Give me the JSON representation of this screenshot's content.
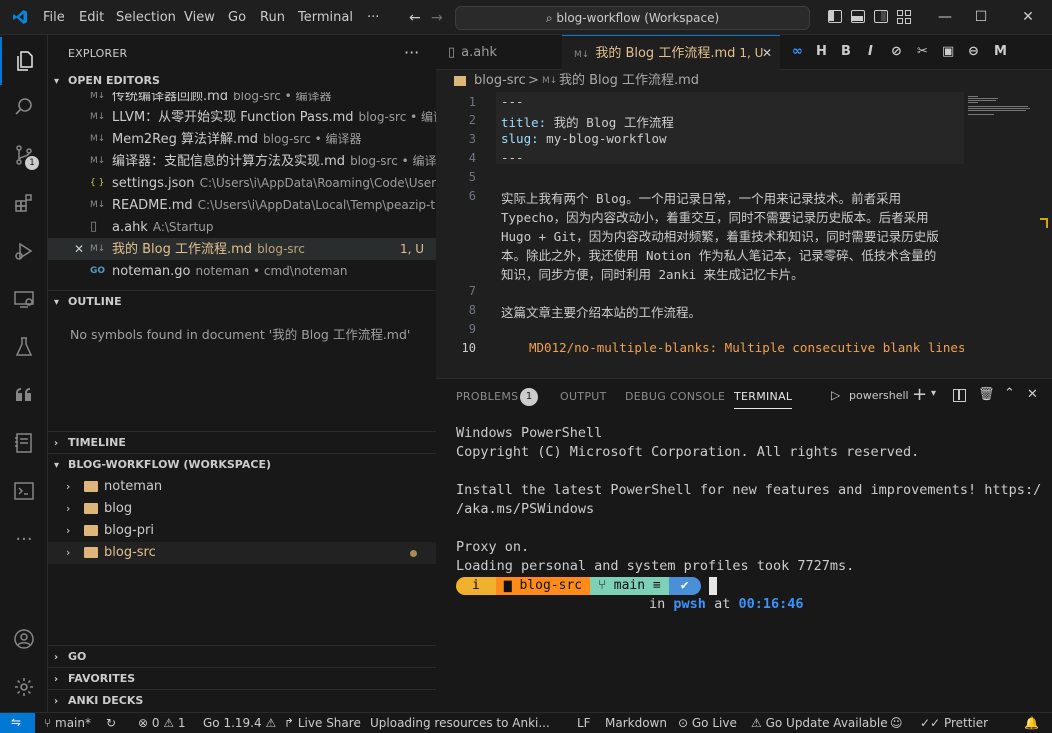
{
  "titlebar": {
    "menus": [
      "File",
      "Edit",
      "Selection",
      "View",
      "Go",
      "Run",
      "Terminal",
      "···"
    ],
    "search": "blog-workflow (Workspace)",
    "minimize": "—",
    "maximize": "☐",
    "close": "✕"
  },
  "activitybar": {
    "scm_badge": "1"
  },
  "sidebar": {
    "title": "EXPLORER",
    "more": "···",
    "open_editors_header": "OPEN EDITORS",
    "open_editors": [
      {
        "icon": "M↓",
        "name": "传统编译器回顾.md",
        "desc": "blog-src • 编译器"
      },
      {
        "icon": "M↓",
        "name": "LLVM：从零开始实现 Function Pass.md",
        "desc": "blog-src • 编译器"
      },
      {
        "icon": "M↓",
        "name": "Mem2Reg 算法详解.md",
        "desc": "blog-src • 编译器"
      },
      {
        "icon": "M↓",
        "name": "编译器：支配信息的计算方法及实现.md",
        "desc": "blog-src • 编译..."
      },
      {
        "icon": "{ }",
        "name": "settings.json",
        "desc": "C:\\Users\\i\\AppData\\Roaming\\Code\\User"
      },
      {
        "icon": "M↓",
        "name": "README.md",
        "desc": "C:\\Users\\i\\AppData\\Local\\Temp\\peazip-tmp\\..."
      },
      {
        "icon": "▯",
        "name": "a.ahk",
        "desc": "A:\\Startup"
      },
      {
        "icon": "M↓",
        "name": "我的 Blog 工作流程.md",
        "desc": "blog-src",
        "status": "1, U"
      },
      {
        "icon": "GO",
        "name": "noteman.go",
        "desc": "noteman • cmd\\noteman"
      }
    ],
    "outline_header": "OUTLINE",
    "outline_empty": "No symbols found in document '我的 Blog 工作流程.md'",
    "timeline_header": "TIMELINE",
    "workspace_header": "BLOG-WORKFLOW (WORKSPACE)",
    "folders": [
      "noteman",
      "blog",
      "blog-pri",
      "blog-src"
    ],
    "go_header": "GO",
    "favorites_header": "FAVORITES",
    "anki_header": "ANKI DECKS"
  },
  "tabs": [
    {
      "label": "a.ahk"
    },
    {
      "label": "我的 Blog 工作流程.md",
      "status": "1, U"
    }
  ],
  "toolbar_icons": [
    "∞",
    "H",
    "B",
    "I",
    "⊘",
    "✂",
    "▣",
    "⊖",
    "M"
  ],
  "breadcrumb": {
    "folder": "blog-src",
    "sep": ">",
    "file": "我的 Blog 工作流程.md"
  },
  "editor": {
    "lines": [
      {
        "n": "1",
        "text": "---"
      },
      {
        "n": "2",
        "key": "title:",
        "val": " 我的 Blog 工作流程"
      },
      {
        "n": "3",
        "key": "slug:",
        "val": " my-blog-workflow"
      },
      {
        "n": "4",
        "text": "---"
      },
      {
        "n": "5",
        "text": ""
      },
      {
        "n": "6",
        "text": "实际上我有两个 Blog。一个用记录日常，一个用来记录技术。前者采用"
      },
      {
        "n": "",
        "text": "Typecho，因为内容改动小，着重交互，同时不需要记录历史版本。后者采用"
      },
      {
        "n": "",
        "text": "Hugo + Git，因为内容改动相对频繁，着重技术和知识，同时需要记录历史版"
      },
      {
        "n": "",
        "text": "本。除此之外，我还使用 Notion 作为私人笔记本，记录零碎、低技术含量的"
      },
      {
        "n": "",
        "text": "知识，同步方便，同时利用 2anki 来生成记忆卡片。"
      },
      {
        "n": "7",
        "text": ""
      },
      {
        "n": "8",
        "text": "这篇文章主要介绍本站的工作流程。"
      },
      {
        "n": "9",
        "text": ""
      },
      {
        "n": "10",
        "text": ""
      }
    ],
    "diagnostic": "MD012/no-multiple-blanks: Multiple consecutive blank lines [E"
  },
  "panel": {
    "tabs": [
      "PROBLEMS",
      "OUTPUT",
      "DEBUG CONSOLE",
      "TERMINAL"
    ],
    "problems_count": "1",
    "shell": "powershell",
    "terminal_lines": [
      "Windows PowerShell",
      "Copyright (C) Microsoft Corporation. All rights reserved.",
      "",
      "Install the latest PowerShell for new features and improvements! https:/",
      "/aka.ms/PSWindows",
      "",
      "Proxy on.",
      "Loading personal and system profiles took 7727ms."
    ],
    "prompt": {
      "user": "i",
      "dir": "blog-src",
      "branch": "main ≡",
      "ok": "✔"
    },
    "prompt2": {
      "in": "in",
      "shell": "pwsh",
      "at": "at",
      "time": "00:16:46"
    }
  },
  "statusbar": {
    "branch": "main*",
    "errors": "0",
    "warnings": "1",
    "go_version": "Go 1.19.4",
    "live_share": "Live Share",
    "uploading": "Uploading resources to Anki...",
    "eol": "LF",
    "lang": "Markdown",
    "go_live": "Go Live",
    "go_update": "Go Update Available",
    "prettier": "Prettier"
  },
  "colors": {
    "accent": "#0078d4",
    "modified": "#e2c08d",
    "key": "#9cdcfe",
    "folder": "#dcb67a"
  }
}
